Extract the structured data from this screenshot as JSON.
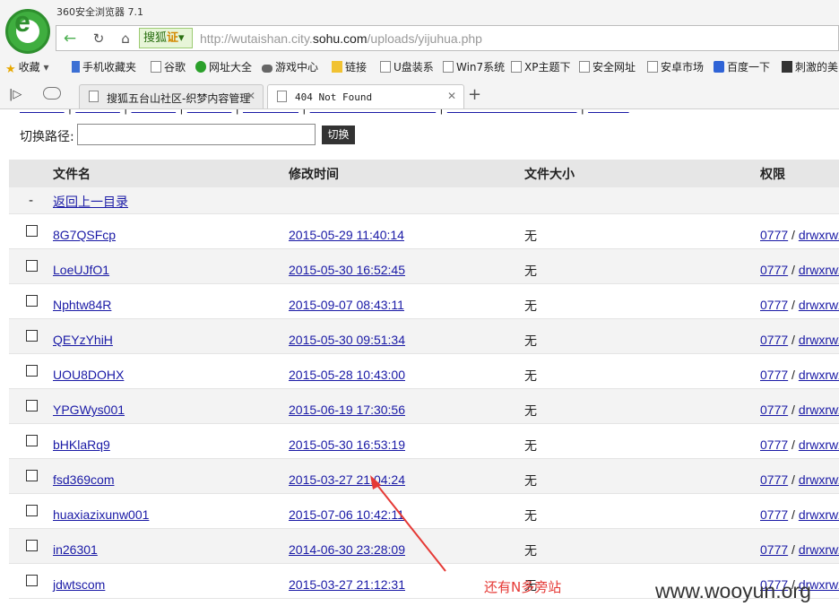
{
  "browser": {
    "window_title": "360安全浏览器 7.1",
    "sohu_label": "搜狐",
    "cert_label": "证",
    "url_prefix": "http://wutaishan.city.",
    "url_host": "sohu.com",
    "url_path": "/uploads/yijuhua.php"
  },
  "bookmarks": [
    {
      "label": "收藏",
      "icon": "star-icon"
    },
    {
      "label": "手机收藏夹",
      "icon": "phone-icon"
    },
    {
      "label": "谷歌",
      "icon": "page-icon"
    },
    {
      "label": "网址大全",
      "icon": "nav-globe-icon"
    },
    {
      "label": "游戏中心",
      "icon": "gamepad-icon"
    },
    {
      "label": "链接",
      "icon": "folder-icon"
    },
    {
      "label": "U盘装系",
      "icon": "page-icon"
    },
    {
      "label": "Win7系统",
      "icon": "page-icon"
    },
    {
      "label": "XP主题下",
      "icon": "page-icon"
    },
    {
      "label": "安全网址",
      "icon": "page-icon"
    },
    {
      "label": "安卓市场",
      "icon": "page-icon"
    },
    {
      "label": "百度一下",
      "icon": "paw-icon"
    },
    {
      "label": "刺激的美",
      "icon": "dark-icon"
    }
  ],
  "tabs": [
    {
      "label": "搜狐五台山社区-织梦内容管理系统"
    },
    {
      "label": "404 Not Found"
    }
  ],
  "page": {
    "path_label": "切换路径:",
    "path_value": "",
    "switch_label": "切换",
    "headers": {
      "name": "文件名",
      "mtime": "修改时间",
      "size": "文件大小",
      "perm": "权限"
    },
    "up_dash": "-",
    "up_label": "返回上一目录",
    "perm_sep": " / "
  },
  "files": [
    {
      "name": "8G7QSFcp",
      "mtime": "2015-05-29 11:40:14",
      "size": "无",
      "perm_num": "0777",
      "perm_str": "drwxrwxrwx"
    },
    {
      "name": "LoeUJfO1",
      "mtime": "2015-05-30 16:52:45",
      "size": "无",
      "perm_num": "0777",
      "perm_str": "drwxrwxrwx"
    },
    {
      "name": "Nphtw84R",
      "mtime": "2015-09-07 08:43:11",
      "size": "无",
      "perm_num": "0777",
      "perm_str": "drwxrwxrwx"
    },
    {
      "name": "QEYzYhiH",
      "mtime": "2015-05-30 09:51:34",
      "size": "无",
      "perm_num": "0777",
      "perm_str": "drwxrwxrwx"
    },
    {
      "name": "UOU8DOHX",
      "mtime": "2015-05-28 10:43:00",
      "size": "无",
      "perm_num": "0777",
      "perm_str": "drwxrwxrwx"
    },
    {
      "name": "YPGWys001",
      "mtime": "2015-06-19 17:30:56",
      "size": "无",
      "perm_num": "0777",
      "perm_str": "drwxrwxrwx"
    },
    {
      "name": "bHKlaRq9",
      "mtime": "2015-05-30 16:53:19",
      "size": "无",
      "perm_num": "0777",
      "perm_str": "drwxrwxrwx"
    },
    {
      "name": "fsd369com",
      "mtime": "2015-03-27 21:04:24",
      "size": "无",
      "perm_num": "0777",
      "perm_str": "drwxrwxrwx"
    },
    {
      "name": "huaxiazixunw001",
      "mtime": "2015-07-06 10:42:11",
      "size": "无",
      "perm_num": "0777",
      "perm_str": "drwxrwxrwx"
    },
    {
      "name": "in26301",
      "mtime": "2014-06-30 23:28:09",
      "size": "无",
      "perm_num": "0777",
      "perm_str": "drwxrwxrwx"
    },
    {
      "name": "jdwtscom",
      "mtime": "2015-03-27 21:12:31",
      "size": "无",
      "perm_num": "0777",
      "perm_str": "drwxrwxrwx"
    }
  ],
  "annotation": {
    "text": "还有N多旁站",
    "color": "#e53935"
  },
  "watermark": "www.wooyun.org"
}
